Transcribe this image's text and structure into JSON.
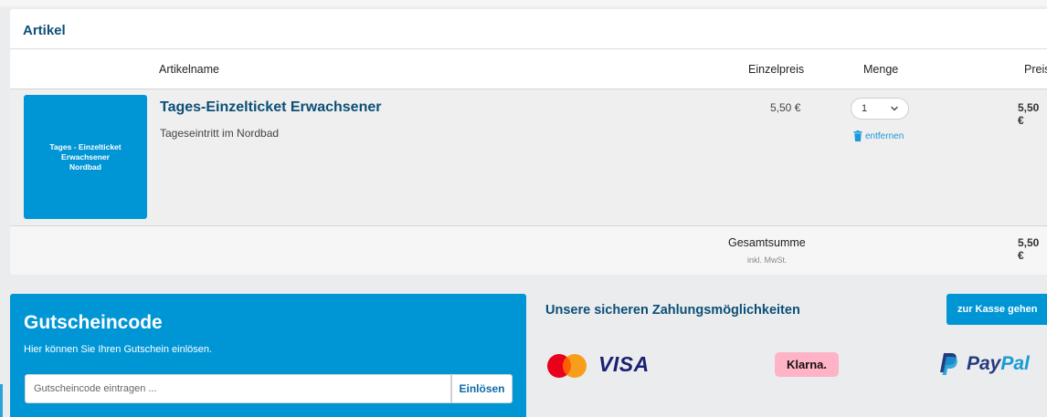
{
  "colors": {
    "brand_blue": "#0096d6",
    "heading_navy": "#0b4f78",
    "link_blue": "#1a9ad9",
    "klarna_pink": "#ffb3c7",
    "visa_navy": "#1a1f71"
  },
  "cart": {
    "title": "Artikel",
    "columns": {
      "name": "Artikelname",
      "unit_price": "Einzelpreis",
      "quantity": "Menge",
      "price": "Preis"
    },
    "items": [
      {
        "thumbnail_text": "Tages - Einzelticket\nErwachsener\nNordbad",
        "name": "Tages-Einzelticket Erwachsener",
        "description": "Tageseintritt im Nordbad",
        "unit_price": "5,50 €",
        "quantity": "1",
        "price": "5,50 €",
        "remove_label": "entfernen",
        "remove_icon": "trash-icon",
        "quantity_icon": "chevron-down-icon"
      }
    ],
    "total": {
      "label": "Gesamtsumme",
      "note": "inkl. MwSt.",
      "value": "5,50 €"
    }
  },
  "voucher": {
    "title": "Gutscheincode",
    "subtitle": "Hier können Sie Ihren Gutschein einlösen.",
    "placeholder": "Gutscheincode eintragen ...",
    "button_label": "Einlösen"
  },
  "payment": {
    "title": "Unsere sicheren Zahlungsmöglichkeiten",
    "checkout_label": "zur Kasse gehen",
    "providers": {
      "mastercard": "mastercard-logo",
      "visa": "VISA",
      "klarna": "Klarna.",
      "paypal_pay": "Pay",
      "paypal_pal": "Pal"
    }
  }
}
